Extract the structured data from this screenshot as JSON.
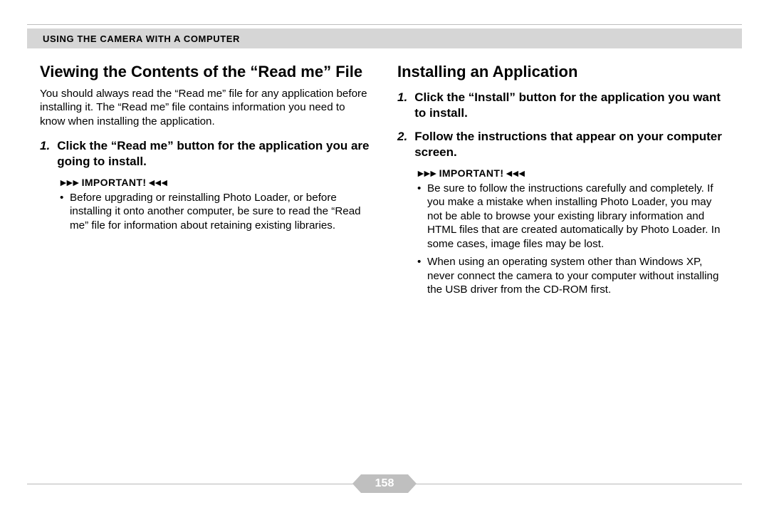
{
  "header": {
    "section_title": "Using the Camera with a Computer"
  },
  "left": {
    "heading": "Viewing the Contents of the “Read me” File",
    "intro": "You should always read the “Read me” file for any application before installing it. The “Read me” file contains information you need to know when installing the application.",
    "steps": [
      {
        "num": "1.",
        "text": "Click the “Read me” button for the application you are going to install."
      }
    ],
    "important_label": "IMPORTANT!",
    "important_bullets": [
      "Before upgrading or reinstalling Photo Loader, or before installing it onto another computer, be sure to read the “Read me” file for information about retaining existing libraries."
    ]
  },
  "right": {
    "heading": "Installing an Application",
    "steps": [
      {
        "num": "1.",
        "text": "Click the “Install” button for the application you want to install."
      },
      {
        "num": "2.",
        "text": "Follow the instructions that appear on your computer screen."
      }
    ],
    "important_label": "IMPORTANT!",
    "important_bullets": [
      "Be sure to follow the instructions carefully and completely. If you make a mistake when installing Photo Loader, you may not be able to browse your existing library information and HTML files that are created automatically by Photo Loader. In some cases, image files may be lost.",
      "When using an operating system other than Windows XP, never connect the camera to your computer without installing the USB driver from the CD-ROM first."
    ]
  },
  "page_number": "158"
}
